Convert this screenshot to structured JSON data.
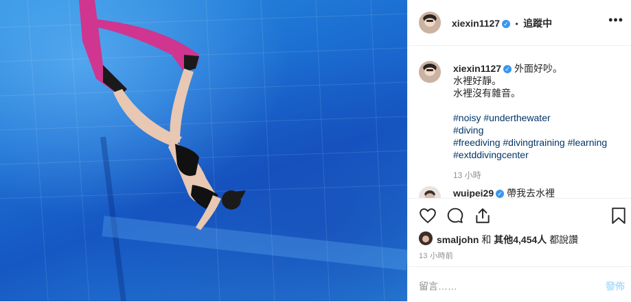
{
  "header": {
    "username": "xiexin1127",
    "verified_icon": "verified-badge-icon",
    "separator": "•",
    "follow_status": "追蹤中",
    "more_icon": "more-options-icon"
  },
  "caption": {
    "username": "xiexin1127",
    "lines": [
      "外面好吵。",
      "水裡好靜。",
      "水裡沒有雜音。"
    ],
    "hashtags_line1": [
      "#noisy",
      "#underthewater"
    ],
    "hashtags_line2": [
      "#diving"
    ],
    "hashtags_line3": [
      "#freediving",
      "#divingtraining",
      "#learning"
    ],
    "hashtags_line4": [
      "#extddivingcenter"
    ],
    "time": "13 小時"
  },
  "next_comment": {
    "username": "wuipei29",
    "text": "帶我去水裡"
  },
  "actions": {
    "like_icon": "heart-icon",
    "comment_icon": "comment-bubble-icon",
    "share_icon": "share-icon",
    "save_icon": "bookmark-icon"
  },
  "likes": {
    "user": "smaljohn",
    "joiner": "和",
    "others": "其他4,454人",
    "suffix": "都說讚"
  },
  "post_time": "13 小時前",
  "comment_box": {
    "placeholder": "留言……",
    "post_label": "發佈"
  }
}
